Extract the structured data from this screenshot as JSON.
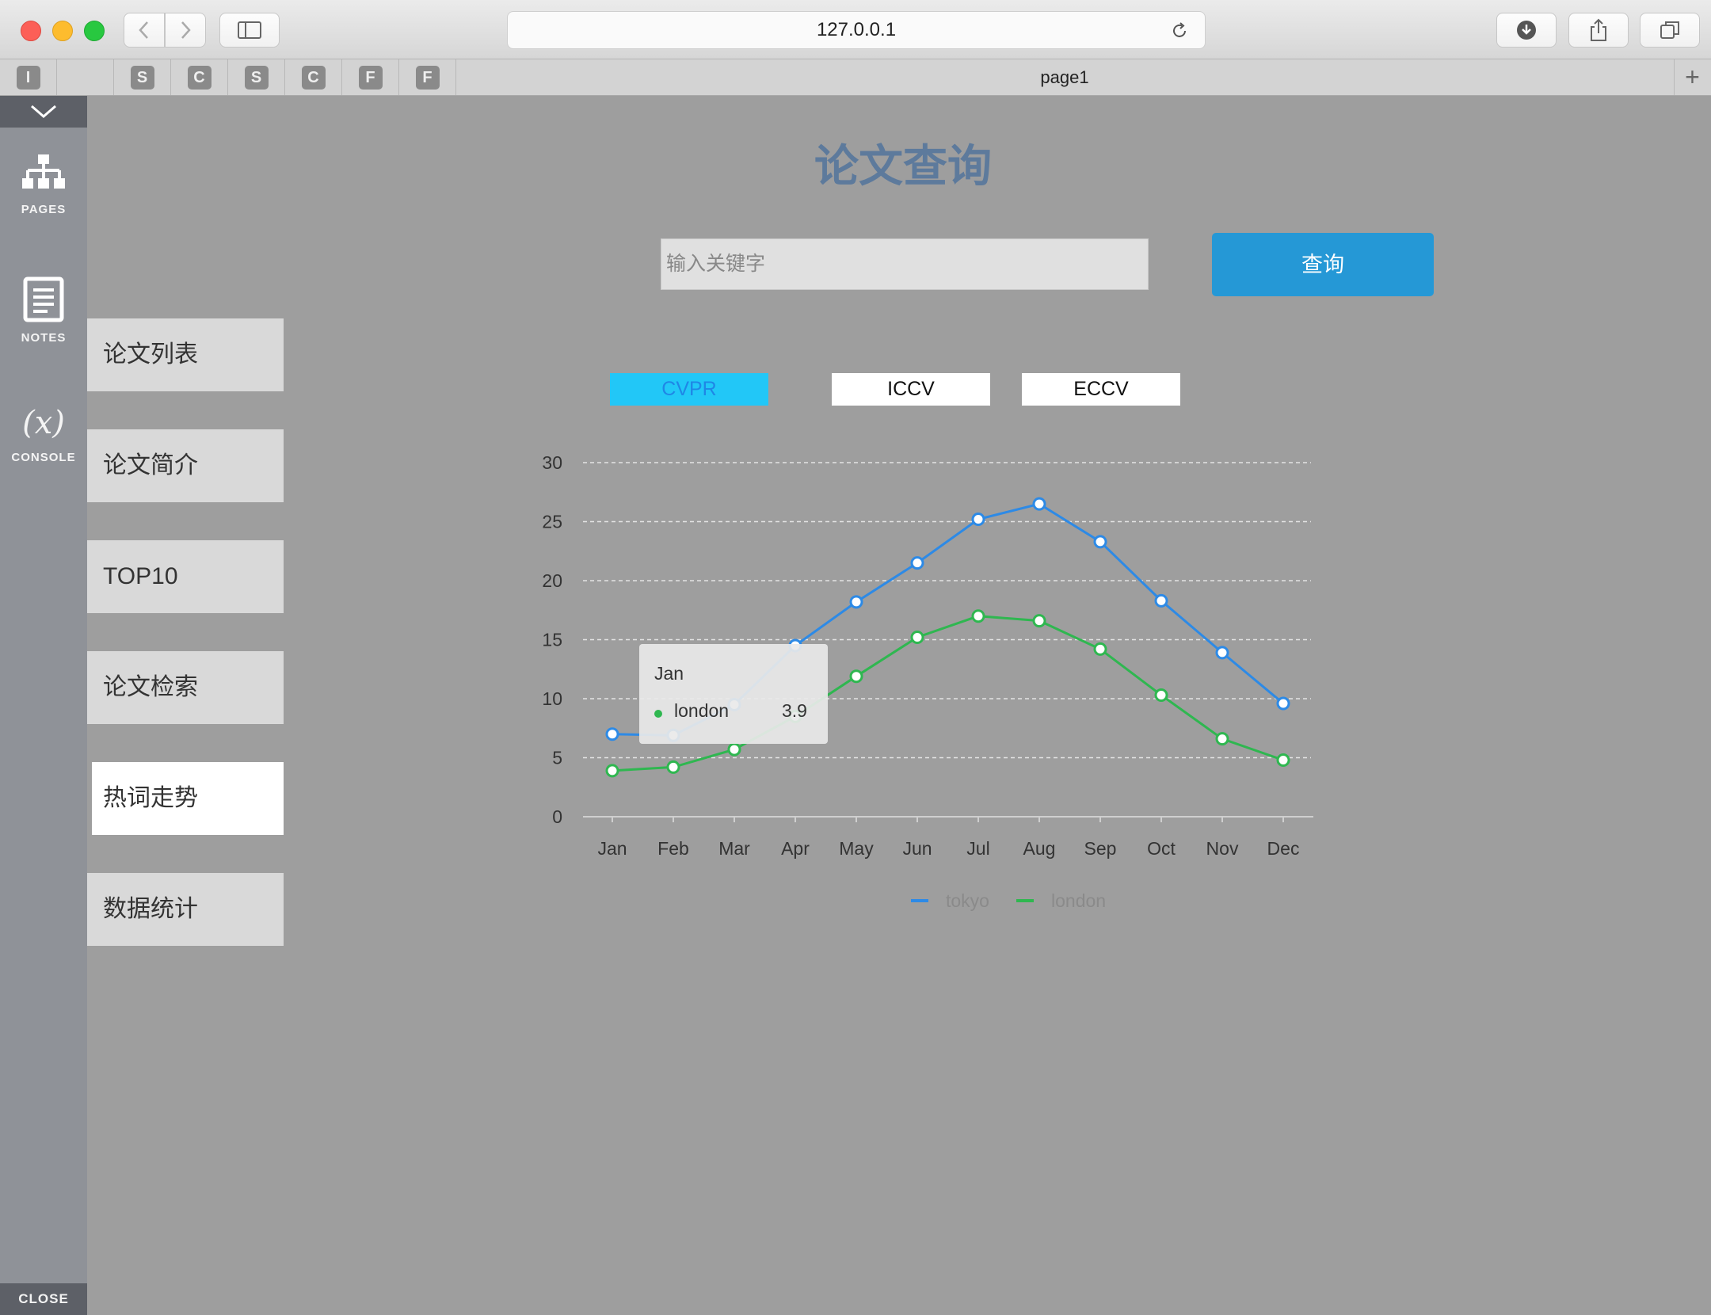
{
  "browser": {
    "url": "127.0.0.1",
    "pinned_tabs": [
      "I",
      "",
      "S",
      "C",
      "S",
      "C",
      "F",
      "F"
    ],
    "active_tab": "page1",
    "new_tab": "+"
  },
  "rail": {
    "items": [
      {
        "label": "PAGES",
        "icon": "sitemap-icon"
      },
      {
        "label": "NOTES",
        "icon": "notes-icon"
      },
      {
        "label": "CONSOLE",
        "icon": "variable-icon",
        "glyph": "(x)"
      }
    ],
    "close": "CLOSE"
  },
  "nav": {
    "items": [
      "论文列表",
      "论文简介",
      "TOP10",
      "论文检索",
      "热词走势",
      "数据统计"
    ],
    "active": "热词走势"
  },
  "page": {
    "title": "论文查询",
    "search_placeholder": "输入关键字",
    "search_button": "查询",
    "conferences": [
      "CVPR",
      "ICCV",
      "ECCV"
    ],
    "active_conference": "CVPR"
  },
  "colors": {
    "tokyo": "#2d8ae6",
    "london": "#2fb750",
    "accent": "#2598d6"
  },
  "chart_data": {
    "type": "line",
    "categories": [
      "Jan",
      "Feb",
      "Mar",
      "Apr",
      "May",
      "Jun",
      "Jul",
      "Aug",
      "Sep",
      "Oct",
      "Nov",
      "Dec"
    ],
    "y_ticks": [
      "0",
      "5",
      "10",
      "15",
      "20",
      "25",
      "30"
    ],
    "ylim": [
      0,
      30
    ],
    "grid": "dashed horizontal",
    "legend": "bottom-center",
    "series": [
      {
        "name": "tokyo",
        "values": [
          7.0,
          6.9,
          9.5,
          14.5,
          18.2,
          21.5,
          25.2,
          26.5,
          23.3,
          18.3,
          13.9,
          9.6
        ]
      },
      {
        "name": "london",
        "values": [
          3.9,
          4.2,
          5.7,
          8.5,
          11.9,
          15.2,
          17.0,
          16.6,
          14.2,
          10.3,
          6.6,
          4.8
        ]
      }
    ],
    "tooltip": {
      "month": "Jan",
      "series": "london",
      "value": "3.9"
    }
  }
}
